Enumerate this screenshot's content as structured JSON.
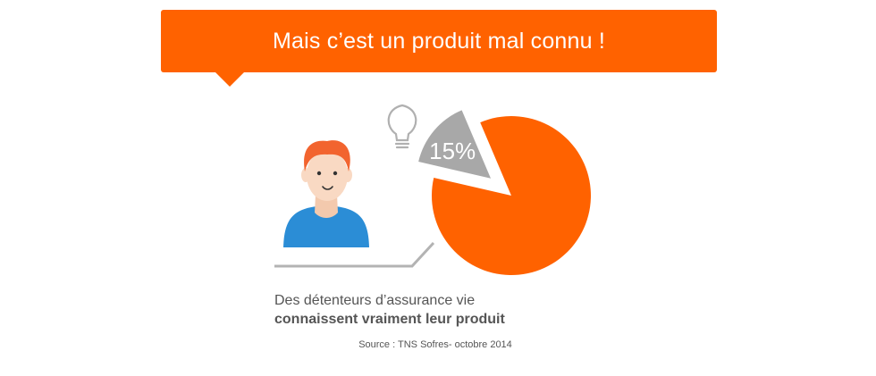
{
  "banner": {
    "title": "Mais c’est un produit mal connu !"
  },
  "chart_data": {
    "type": "pie",
    "slices": [
      {
        "label": "15%",
        "value": 15,
        "color": "#a8a8a8"
      },
      {
        "label": "",
        "value": 85,
        "color": "#ff6200"
      }
    ]
  },
  "caption": {
    "line1": "Des détenteurs d’assurance vie",
    "line2": "connaissent vraiment leur produit"
  },
  "source": "Source : TNS Sofres- octobre 2014",
  "colors": {
    "accent": "#ff6200",
    "gray": "#a8a8a8",
    "skin": "#f9d9c3",
    "hair": "#f2642f",
    "shirt": "#2b8dd6"
  },
  "icons": [
    "lightbulb-icon",
    "person-avatar"
  ]
}
